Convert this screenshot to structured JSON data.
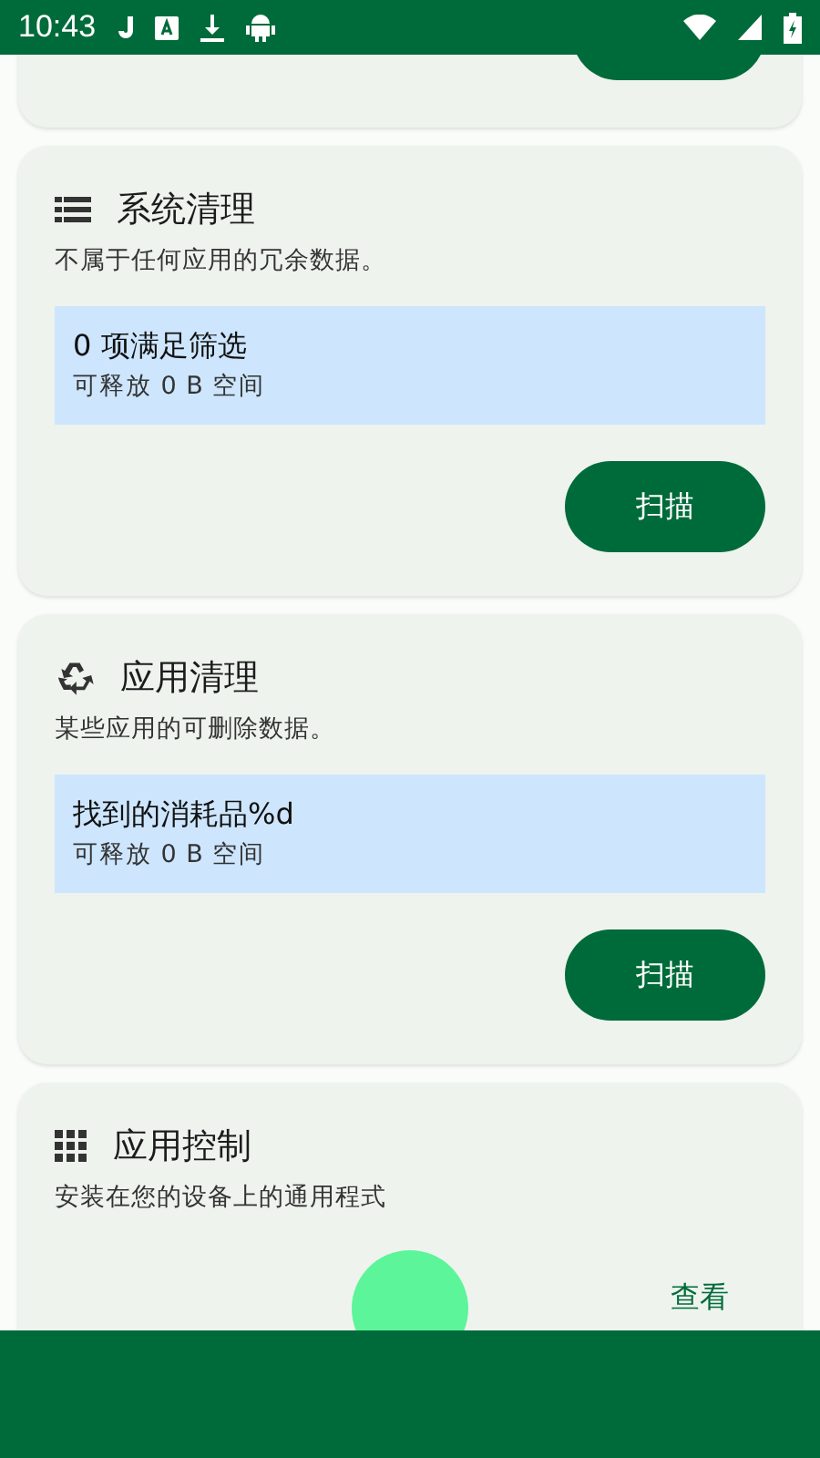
{
  "status_bar": {
    "time": "10:43"
  },
  "cards": [
    {
      "kind": "result",
      "title": "系统清理",
      "description": "不属于任何应用的冗余数据。",
      "result": {
        "title": "0 项满足筛选",
        "subtitle": "可释放 0 B 空间"
      },
      "action": "扫描"
    },
    {
      "kind": "result",
      "title": "应用清理",
      "description": "某些应用的可删除数据。",
      "result": {
        "title": "找到的消耗品%d",
        "subtitle": "可释放 0 B 空间"
      },
      "action": "扫描"
    },
    {
      "kind": "browse",
      "title": "应用控制",
      "description": "安装在您的设备上的通用程式",
      "action": "查看"
    }
  ]
}
